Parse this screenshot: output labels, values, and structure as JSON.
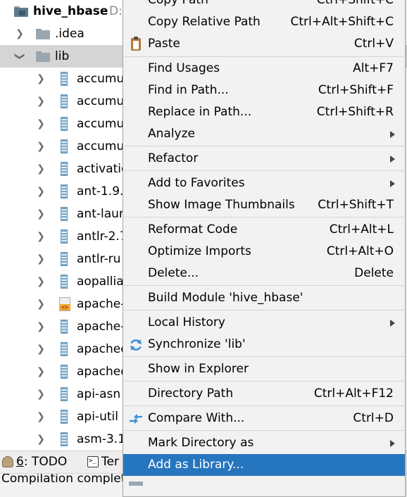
{
  "project_tree": {
    "root": {
      "name": "hive_hbase",
      "suffix": "D:"
    },
    "folders": [
      {
        "name": ".idea"
      },
      {
        "name": "lib"
      }
    ],
    "lib_items": [
      {
        "label": "accumu",
        "icon": "jar-icon"
      },
      {
        "label": "accumu",
        "icon": "jar-icon"
      },
      {
        "label": "accumu",
        "icon": "jar-icon"
      },
      {
        "label": "accumu",
        "icon": "jar-icon"
      },
      {
        "label": "activatio",
        "icon": "jar-icon"
      },
      {
        "label": "ant-1.9.",
        "icon": "jar-icon"
      },
      {
        "label": "ant-laun",
        "icon": "jar-icon"
      },
      {
        "label": "antlr-2.7",
        "icon": "jar-icon"
      },
      {
        "label": "antlr-ru",
        "icon": "jar-icon"
      },
      {
        "label": "aopallia",
        "icon": "jar-icon"
      },
      {
        "label": "apache-",
        "icon": "xml-file-icon"
      },
      {
        "label": "apache-",
        "icon": "jar-icon"
      },
      {
        "label": "apached",
        "icon": "jar-icon"
      },
      {
        "label": "apached",
        "icon": "jar-icon"
      },
      {
        "label": "api-asn",
        "icon": "jar-icon"
      },
      {
        "label": "api-util",
        "icon": "jar-icon"
      },
      {
        "label": "asm-3.1",
        "icon": "jar-icon"
      }
    ]
  },
  "bottom_bar": {
    "todo": {
      "mnemonic": "6",
      "rest": ": TODO"
    },
    "terminal": {
      "label": "Ter"
    }
  },
  "status_bar": {
    "text": "Compilation complet"
  },
  "context_menu": {
    "items": [
      {
        "id": "copy-path",
        "label": "Copy Path",
        "shortcut": "Ctrl+Shift+C"
      },
      {
        "id": "copy-relative-path",
        "label": "Copy Relative Path",
        "shortcut": "Ctrl+Alt+Shift+C"
      },
      {
        "id": "paste",
        "label": "Paste",
        "shortcut": "Ctrl+V",
        "icon": "paste-icon"
      },
      {
        "id": "find-usages",
        "label": "Find Usages",
        "shortcut": "Alt+F7"
      },
      {
        "id": "find-in-path",
        "label": "Find in Path...",
        "shortcut": "Ctrl+Shift+F"
      },
      {
        "id": "replace-in-path",
        "label": "Replace in Path...",
        "shortcut": "Ctrl+Shift+R"
      },
      {
        "id": "analyze",
        "label": "Analyze",
        "submenu": true
      },
      {
        "id": "refactor",
        "label": "Refactor",
        "submenu": true
      },
      {
        "id": "add-to-favorites",
        "label": "Add to Favorites",
        "submenu": true
      },
      {
        "id": "show-image-thumbnails",
        "label": "Show Image Thumbnails",
        "shortcut": "Ctrl+Shift+T"
      },
      {
        "id": "reformat-code",
        "label": "Reformat Code",
        "shortcut": "Ctrl+Alt+L"
      },
      {
        "id": "optimize-imports",
        "label": "Optimize Imports",
        "shortcut": "Ctrl+Alt+O"
      },
      {
        "id": "delete",
        "label": "Delete...",
        "shortcut": "Delete"
      },
      {
        "id": "build-module",
        "label": "Build Module 'hive_hbase'"
      },
      {
        "id": "local-history",
        "label": "Local History",
        "submenu": true
      },
      {
        "id": "synchronize",
        "label": "Synchronize 'lib'",
        "icon": "sync-icon"
      },
      {
        "id": "show-in-explorer",
        "label": "Show in Explorer"
      },
      {
        "id": "directory-path",
        "label": "Directory Path",
        "shortcut": "Ctrl+Alt+F12"
      },
      {
        "id": "compare-with",
        "label": "Compare With...",
        "shortcut": "Ctrl+D",
        "icon": "compare-icon"
      },
      {
        "id": "mark-directory-as",
        "label": "Mark Directory as",
        "submenu": true
      },
      {
        "id": "add-as-library",
        "label": "Add as Library...",
        "selected": true
      }
    ]
  },
  "colors": {
    "menu_selection": "#2675bf",
    "tree_selection": "#d5d5d5",
    "menu_background": "#f2f2f2"
  }
}
